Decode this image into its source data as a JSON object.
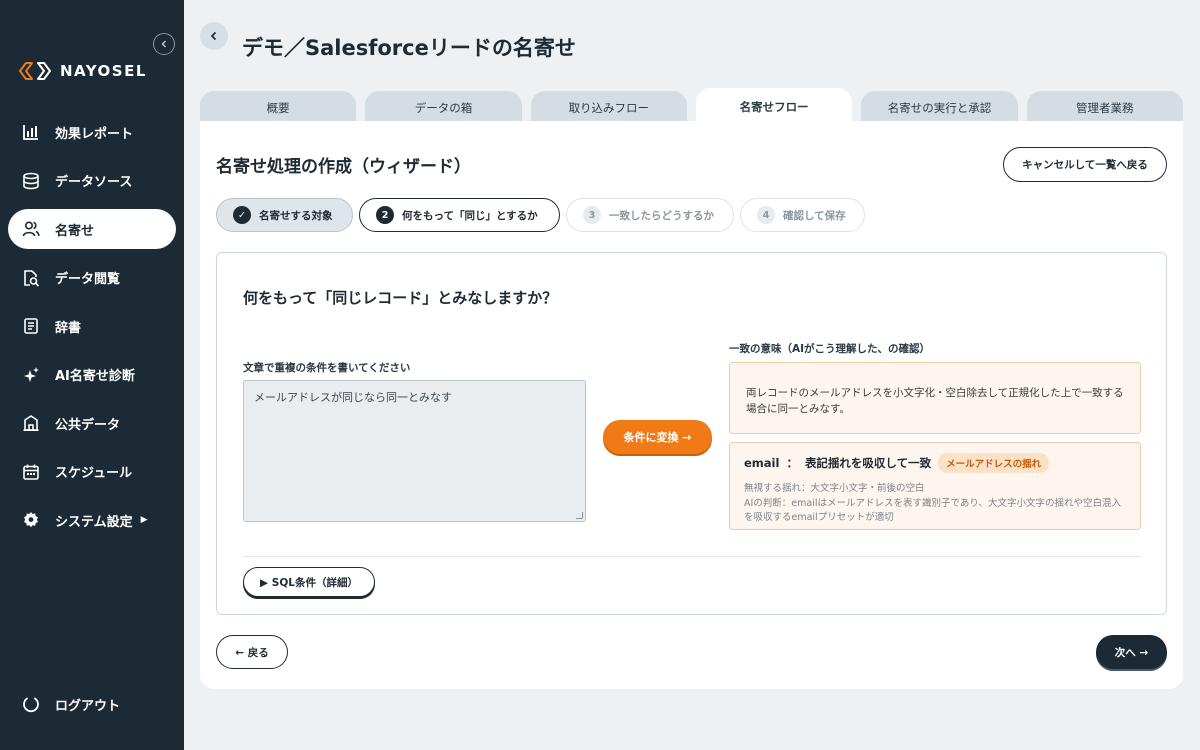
{
  "app": {
    "logo_text": "NAYOSEL"
  },
  "sidebar": {
    "items": [
      {
        "label": "効果レポート",
        "icon": "bar-chart-icon"
      },
      {
        "label": "データソース",
        "icon": "database-icon"
      },
      {
        "label": "名寄せ",
        "icon": "users-icon",
        "active": true
      },
      {
        "label": "データ閲覧",
        "icon": "search-doc-icon"
      },
      {
        "label": "辞書",
        "icon": "book-icon"
      },
      {
        "label": "AI名寄せ診断",
        "icon": "sparkle-icon"
      },
      {
        "label": "公共データ",
        "icon": "building-icon"
      },
      {
        "label": "スケジュール",
        "icon": "calendar-icon"
      },
      {
        "label": "システム設定",
        "icon": "gear-icon",
        "arrow": "▶"
      }
    ],
    "logout_label": "ログアウト"
  },
  "header": {
    "title": "デモ／Salesforceリードの名寄せ"
  },
  "tabs": [
    {
      "label": "概要"
    },
    {
      "label": "データの箱"
    },
    {
      "label": "取り込みフロー"
    },
    {
      "label": "名寄せフロー",
      "active": true
    },
    {
      "label": "名寄せの実行と承認"
    },
    {
      "label": "管理者業務"
    }
  ],
  "wizard": {
    "title": "名寄せ処理の作成（ウィザード）",
    "cancel_label": "キャンセルして一覧へ戻る",
    "steps": [
      {
        "num": "✓",
        "label": "名寄せする対象",
        "state": "done"
      },
      {
        "num": "2",
        "label": "何をもって「同じ」とするか",
        "state": "current"
      },
      {
        "num": "3",
        "label": "一致したらどうするか",
        "state": "future"
      },
      {
        "num": "4",
        "label": "確認して保存",
        "state": "future"
      }
    ],
    "question": "何をもって「同じレコード」とみなしますか？",
    "input_label": "文章で重複の条件を書いてください",
    "input_value": "メールアドレスが同じなら同一とみなす",
    "convert_label": "条件に変換 →",
    "meaning_label": "一致の意味（AIがこう理解した、の確認）",
    "meaning_text": "両レコードのメールアドレスを小文字化・空白除去して正規化した上で一致する場合に同一とみなす。",
    "condition": {
      "field": "email",
      "sep": "：",
      "rule": "表記揺れを吸収して一致",
      "badge": "メールアドレスの揺れ",
      "ignore": "無視する揺れ：大文字小文字・前後の空白",
      "ai_note": "AIの判断：emailはメールアドレスを表す識別子であり、大文字小文字の揺れや空白混入を吸収するemailプリセットが適切"
    },
    "sql_label": "▶ SQL条件（詳細）",
    "back_label": "← 戻る",
    "next_label": "次へ →"
  },
  "colors": {
    "sidebar_bg": "#1b2a35",
    "accent_orange": "#ef7a16",
    "badge_text": "#c95a05"
  }
}
